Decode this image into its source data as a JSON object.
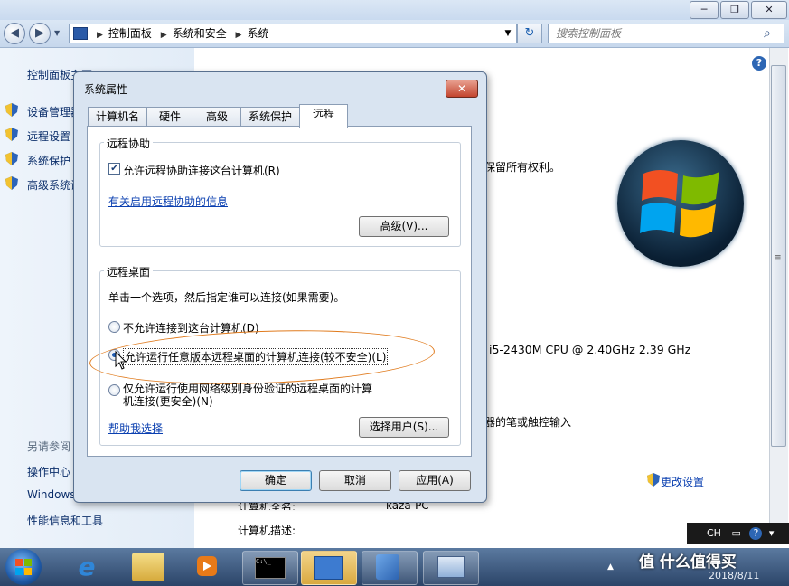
{
  "window": {
    "controls": {
      "minimize": "─",
      "maximize": "❐",
      "close": "✕"
    }
  },
  "nav": {
    "back": "◀",
    "forward": "▶",
    "breadcrumbs": [
      "控制面板",
      "系统和安全",
      "系统"
    ],
    "search_placeholder": "搜索控制面板"
  },
  "left_pane": {
    "title": "控制面板主页",
    "items": [
      "设备管理器",
      "远程设置",
      "系统保护",
      "高级系统设置"
    ],
    "see_also": "另请参阅",
    "bottom_links": [
      "操作中心",
      "Windows Update",
      "性能信息和工具"
    ]
  },
  "main": {
    "copyright_fragment": "保留所有权利。",
    "cpu_fragment": "i5-2430M CPU @ 2.40GHz   2.39 GHz",
    "pen_fragment": "器的笔或触控输入",
    "change_settings": "更改设置",
    "computer_fullname_label": "计算机全名:",
    "computer_fullname_value": "kaza-PC",
    "computer_desc_label": "计算机描述:"
  },
  "dialog": {
    "title": "系统属性",
    "close": "✕",
    "tabs": [
      "计算机名",
      "硬件",
      "高级",
      "系统保护",
      "远程"
    ],
    "active_tab": "远程",
    "remote_assistance": {
      "group_label": "远程协助",
      "allow_checkbox": "允许远程协助连接这台计算机(R)",
      "allow_checked": true,
      "info_link": "有关启用远程协助的信息",
      "advanced_button": "高级(V)..."
    },
    "remote_desktop": {
      "group_label": "远程桌面",
      "instruction": "单击一个选项，然后指定谁可以连接(如果需要)。",
      "options": [
        "不允许连接到这台计算机(D)",
        "允许运行任意版本远程桌面的计算机连接(较不安全)(L)",
        "仅允许运行使用网络级别身份验证的远程桌面的计算机连接(更安全)(N)"
      ],
      "option3_line1": "仅允许运行使用网络级别身份验证的远程桌面的计算",
      "option3_line2": "机连接(更安全)(N)",
      "selected_index": 1,
      "help_link": "帮助我选择",
      "select_users_button": "选择用户(S)..."
    },
    "buttons": {
      "ok": "确定",
      "cancel": "取消",
      "apply": "应用(A)"
    }
  },
  "taskbar": {
    "language": "CH",
    "help": "?",
    "date": "2018/8/11",
    "watermark": "值 什么值得买"
  }
}
